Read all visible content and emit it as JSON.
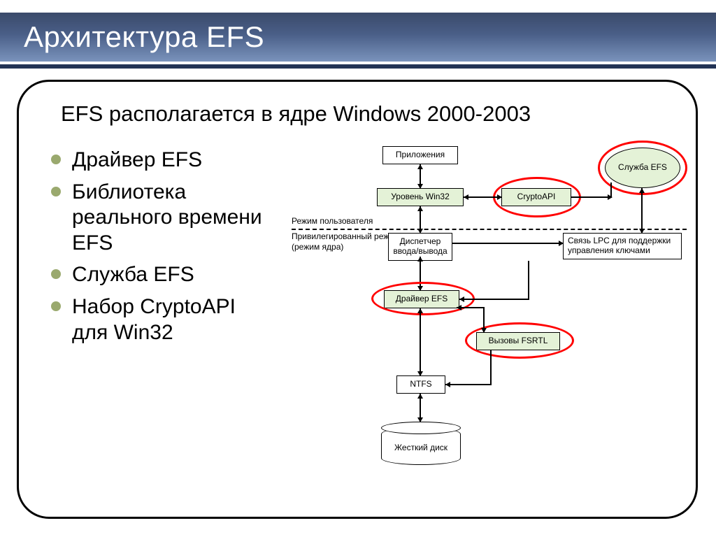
{
  "title": "Архитектура EFS",
  "subtitle": "EFS располагается в ядре Windows 2000-2003",
  "bullets": [
    "Драйвер EFS",
    "Библиотека реального времени EFS",
    "Служба EFS",
    "Набор CryptoAPI для Win32"
  ],
  "diagram": {
    "apps": "Приложения",
    "win32": "Уровень Win32",
    "cryptoapi": "CryptoAPI",
    "efs_service": "Служба EFS",
    "user_mode": "Режим пользователя",
    "kernel_mode_line1": "Привилегированный режим",
    "kernel_mode_line2": "(режим ядра)",
    "io_mgr": "Диспетчер ввода/вывода",
    "lpc": "Связь LPC для поддержки управления ключами",
    "efs_driver": "Драйвер EFS",
    "fsrtl": "Вызовы FSRTL",
    "ntfs": "NTFS",
    "disk": "Жесткий диск"
  }
}
